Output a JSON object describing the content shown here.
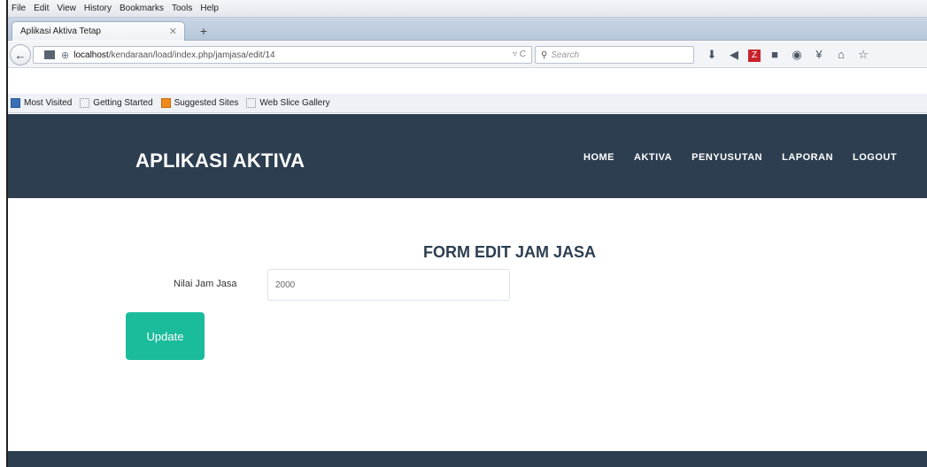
{
  "browser": {
    "menu": [
      "File",
      "Edit",
      "View",
      "History",
      "Bookmarks",
      "Tools",
      "Help"
    ],
    "tab_title": "Aplikasi Aktiva Tetap",
    "url_host": "localhost",
    "url_path": "/kendaraan/load/index.php/jamjasa/edit/14",
    "search_placeholder": "Search",
    "bookmarks": [
      "Most Visited",
      "Getting Started",
      "Suggested Sites",
      "Web Slice Gallery"
    ]
  },
  "site": {
    "brand": "APLIKASI AKTIVA",
    "nav": [
      "HOME",
      "AKTIVA",
      "PENYUSUTAN",
      "LAPORAN",
      "LOGOUT"
    ]
  },
  "form": {
    "title": "FORM EDIT JAM JASA",
    "field_label": "Nilai Jam Jasa",
    "field_value": "2000",
    "button_label": "Update"
  },
  "colors": {
    "header_bg": "#2c3e50",
    "button_bg": "#1abc9c"
  }
}
